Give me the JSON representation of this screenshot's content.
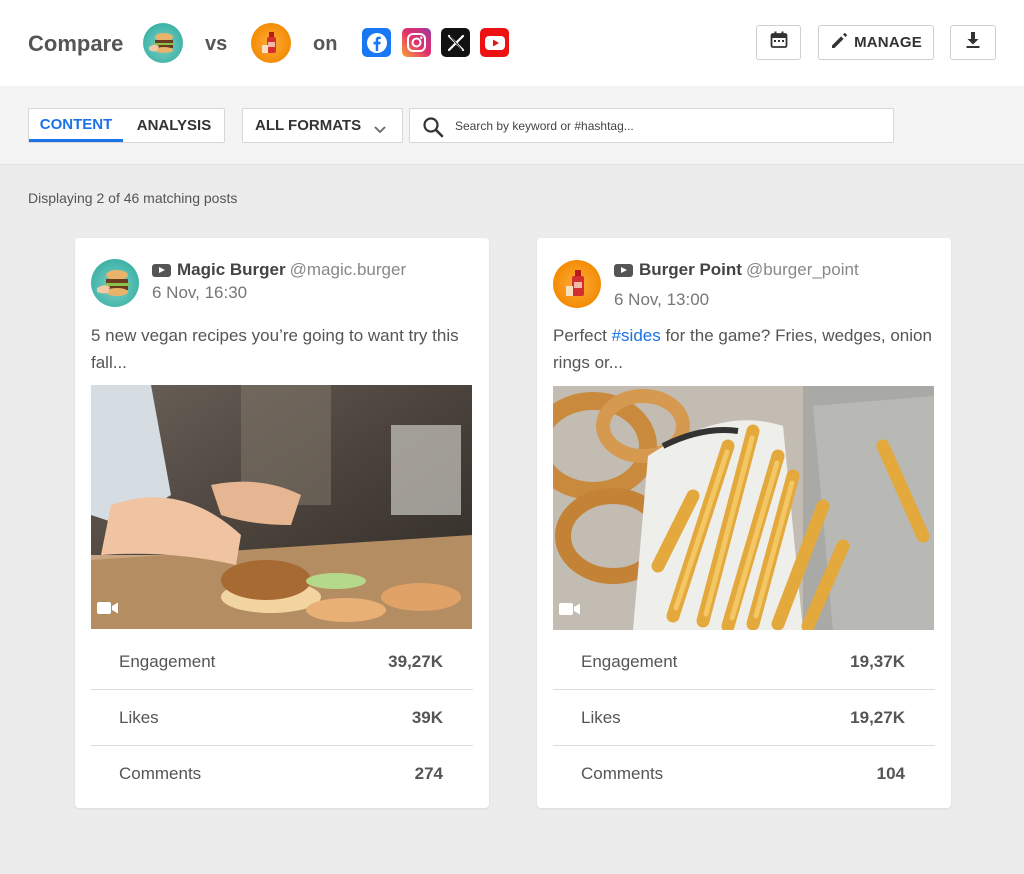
{
  "header": {
    "compare_label": "Compare",
    "vs_label": "vs",
    "on_label": "on",
    "accounts": [
      {
        "name": "Magic Burger",
        "avatar_icon": "burger-avatar-icon"
      },
      {
        "name": "Burger Point",
        "avatar_icon": "ketchup-avatar-icon"
      }
    ],
    "networks": [
      {
        "name": "Facebook",
        "icon": "facebook-icon",
        "color": "#1877f2"
      },
      {
        "name": "Instagram",
        "icon": "instagram-icon",
        "color": "#e1306c"
      },
      {
        "name": "X",
        "icon": "x-icon",
        "color": "#111111"
      },
      {
        "name": "YouTube",
        "icon": "youtube-icon",
        "color": "#ee1111"
      }
    ],
    "calendar_icon": "calendar-icon",
    "manage_label": "MANAGE",
    "download_icon": "download-icon"
  },
  "toolbar": {
    "tabs": [
      {
        "label": "CONTENT",
        "active": true
      },
      {
        "label": "ANALYSIS",
        "active": false
      }
    ],
    "formats_label": "ALL FORMATS",
    "search_placeholder": "Search by keyword or #hashtag...",
    "search_value": ""
  },
  "results": {
    "display_text": "Displaying 2 of 46 matching posts"
  },
  "posts": [
    {
      "account": "Magic Burger",
      "handle": "@magic.burger",
      "network_icon": "youtube-icon",
      "date": "6 Nov, 16:30",
      "text": "5 new vegan recipes you’re going to want try this fall...",
      "media_type": "video",
      "stats": [
        {
          "label": "Engagement",
          "value": "39,27K"
        },
        {
          "label": "Likes",
          "value": "39K"
        },
        {
          "label": "Comments",
          "value": "274"
        }
      ]
    },
    {
      "account": "Burger Point",
      "handle": "@burger_point",
      "network_icon": "youtube-icon",
      "date": "6 Nov, 13:00",
      "text_before": "Perfect ",
      "hashtag": "#sides",
      "text_after": " for the game? Fries, wedges, onion rings or...",
      "media_type": "video",
      "stats": [
        {
          "label": "Engagement",
          "value": "19,37K"
        },
        {
          "label": "Likes",
          "value": "19,27K"
        },
        {
          "label": "Comments",
          "value": "104"
        }
      ]
    }
  ],
  "colors": {
    "accent": "#1a73e8",
    "background": "#ececec"
  }
}
